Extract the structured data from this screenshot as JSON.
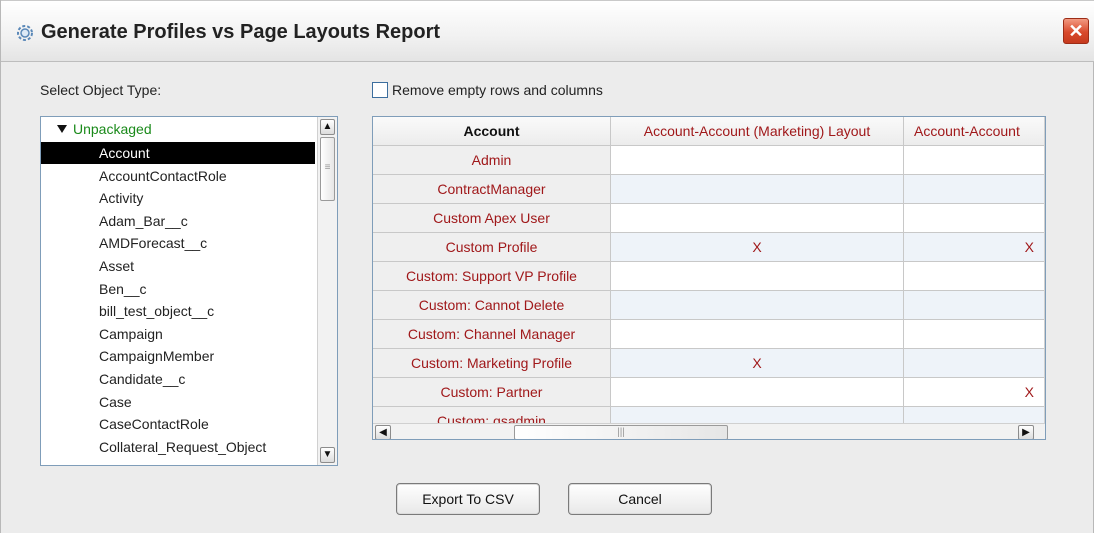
{
  "window": {
    "title": "Generate Profiles vs Page Layouts Report",
    "close_label": "✕"
  },
  "left": {
    "label": "Select Object Type:",
    "tree_root": "Unpackaged",
    "items": [
      "Account",
      "AccountContactRole",
      "Activity",
      "Adam_Bar__c",
      "AMDForecast__c",
      "Asset",
      "Ben__c",
      "bill_test_object__c",
      "Campaign",
      "CampaignMember",
      "Candidate__c",
      "Case",
      "CaseContactRole",
      "Collateral_Request_Object"
    ],
    "selected_index": 0
  },
  "options": {
    "remove_empty_label": "Remove empty rows and columns",
    "remove_empty_checked": false
  },
  "table": {
    "corner_header": "Account",
    "columns": [
      "Account-Account (Marketing) Layout",
      "Account-Account"
    ],
    "rows": [
      {
        "profile": "Admin",
        "c1": "",
        "c2": ""
      },
      {
        "profile": "ContractManager",
        "c1": "",
        "c2": ""
      },
      {
        "profile": "Custom Apex User",
        "c1": "",
        "c2": ""
      },
      {
        "profile": "Custom Profile",
        "c1": "X",
        "c2": "X"
      },
      {
        "profile": "Custom:  Support VP Profile",
        "c1": "",
        "c2": ""
      },
      {
        "profile": "Custom: Cannot Delete",
        "c1": "",
        "c2": ""
      },
      {
        "profile": "Custom: Channel Manager",
        "c1": "",
        "c2": ""
      },
      {
        "profile": "Custom: Marketing Profile",
        "c1": "X",
        "c2": ""
      },
      {
        "profile": "Custom: Partner",
        "c1": "",
        "c2": "X"
      },
      {
        "profile": "Custom: qsadmin",
        "c1": "",
        "c2": ""
      }
    ]
  },
  "buttons": {
    "export": "Export To CSV",
    "cancel": "Cancel"
  },
  "icons": {
    "title": "gear-icon",
    "up": "▲",
    "down": "▼",
    "left": "◀",
    "right": "▶"
  }
}
